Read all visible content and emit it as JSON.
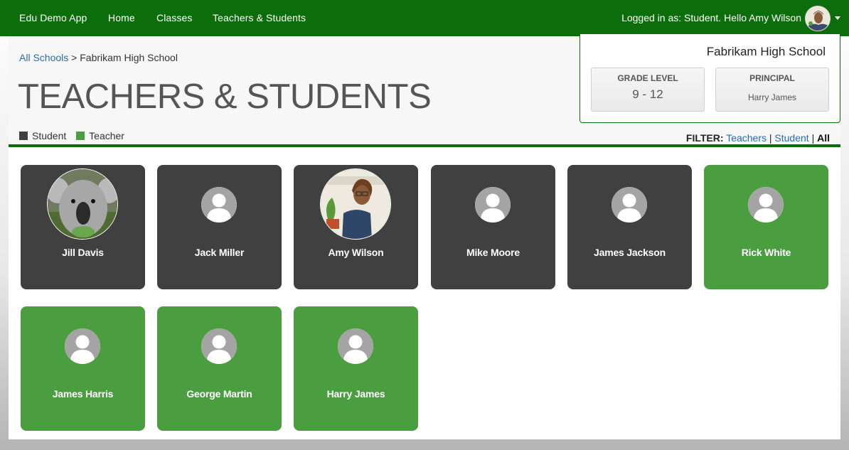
{
  "nav": {
    "brand": "Edu Demo App",
    "links": [
      "Home",
      "Classes",
      "Teachers & Students"
    ],
    "user_text": "Logged in as: Student. Hello Amy Wilson"
  },
  "breadcrumb": {
    "root": "All Schools",
    "separator": ">",
    "current": "Fabrikam High School"
  },
  "page_title": "TEACHERS & STUDENTS",
  "legend": {
    "student": "Student",
    "teacher": "Teacher"
  },
  "filter": {
    "label": "FILTER:",
    "teachers": "Teachers",
    "sep": "|",
    "student": "Student",
    "all": "All"
  },
  "school": {
    "name": "Fabrikam High School",
    "grade_label": "GRADE LEVEL",
    "grade_value": "9 - 12",
    "principal_label": "PRINCIPAL",
    "principal_value": "Harry James"
  },
  "people": [
    {
      "name": "Jill Davis",
      "role": "student",
      "avatar": "koala-photo"
    },
    {
      "name": "Jack Miller",
      "role": "student",
      "avatar": "default-avatar-icon"
    },
    {
      "name": "Amy Wilson",
      "role": "student",
      "avatar": "illustrated-person-photo"
    },
    {
      "name": "Mike Moore",
      "role": "student",
      "avatar": "default-avatar-icon"
    },
    {
      "name": "James Jackson",
      "role": "student",
      "avatar": "default-avatar-icon"
    },
    {
      "name": "Rick White",
      "role": "teacher",
      "avatar": "default-avatar-icon"
    },
    {
      "name": "James Harris",
      "role": "teacher",
      "avatar": "default-avatar-icon"
    },
    {
      "name": "George Martin",
      "role": "teacher",
      "avatar": "default-avatar-icon"
    },
    {
      "name": "Harry James",
      "role": "teacher",
      "avatar": "default-avatar-icon"
    }
  ],
  "colors": {
    "nav_green": "#0b6e0b",
    "student": "#404040",
    "teacher": "#4a9e3f",
    "link": "#2a6bb0"
  }
}
